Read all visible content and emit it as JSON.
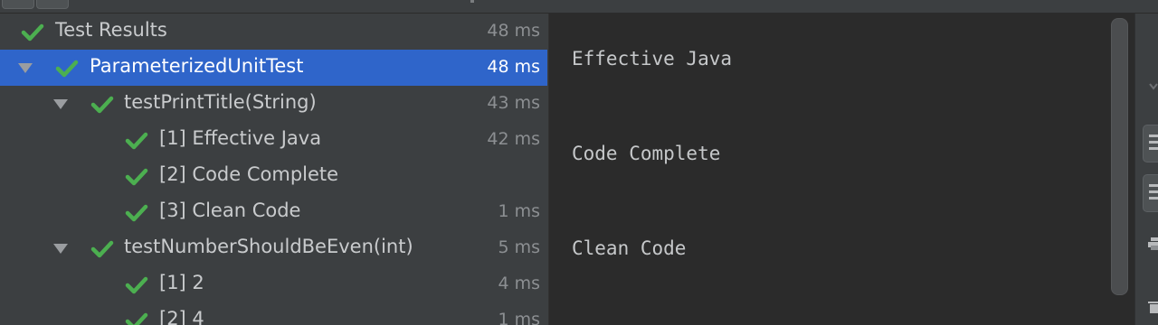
{
  "test_tree": {
    "rows": [
      {
        "label": "Test Results",
        "time": "48 ms",
        "status": "passed"
      },
      {
        "label": "ParameterizedUnitTest",
        "time": "48 ms",
        "status": "passed",
        "selected": true
      },
      {
        "label": "testPrintTitle(String)",
        "time": "43 ms",
        "status": "passed"
      },
      {
        "label": "[1] Effective Java",
        "time": "42 ms",
        "status": "passed"
      },
      {
        "label": "[2] Code Complete",
        "time": "",
        "status": "passed"
      },
      {
        "label": "[3] Clean Code",
        "time": "1 ms",
        "status": "passed"
      },
      {
        "label": "testNumberShouldBeEven(int)",
        "time": "5 ms",
        "status": "passed"
      },
      {
        "label": "[1] 2",
        "time": "4 ms",
        "status": "passed"
      },
      {
        "label": "[2] 4",
        "time": "1 ms",
        "status": "passed"
      }
    ]
  },
  "console": {
    "lines": [
      "Effective Java",
      "Code Complete",
      "Clean Code"
    ]
  },
  "icons": {
    "pass": "check-icon",
    "expand": "expand-arrow-icon",
    "right_toolbar": [
      "layout-icon",
      "layout-icon",
      "print-icon",
      "trash-icon"
    ]
  },
  "colors": {
    "pass_green": "#4caf50",
    "selection_blue": "#2f65ca",
    "panel_bg": "#3c3f41",
    "console_bg": "#2b2b2b"
  }
}
